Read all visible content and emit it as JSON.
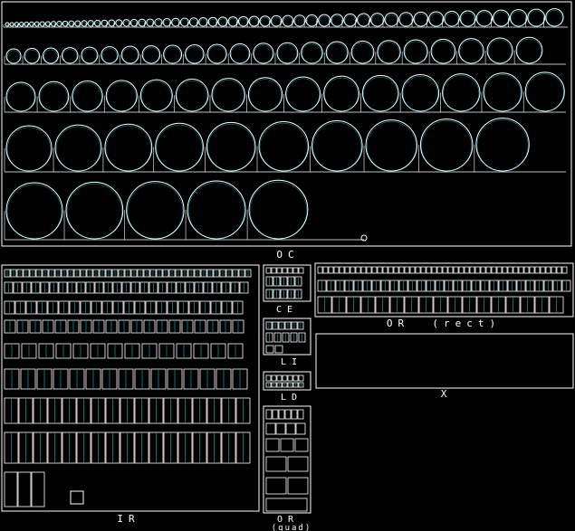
{
  "drawing": {
    "background": "#000000",
    "line_color": "#ffffff",
    "accent_color": "#00e5ff",
    "sections": {
      "oc": {
        "label": "OC"
      },
      "ce": {
        "label": "CE"
      },
      "li": {
        "label": "LI"
      },
      "ld": {
        "label": "LD"
      },
      "or_rect": {
        "label": "OR  (rect)"
      },
      "x": {
        "label": "X"
      },
      "ir": {
        "label": "IR"
      },
      "or_quad": {
        "label": "OR",
        "sublabel": "(quad)"
      }
    }
  }
}
